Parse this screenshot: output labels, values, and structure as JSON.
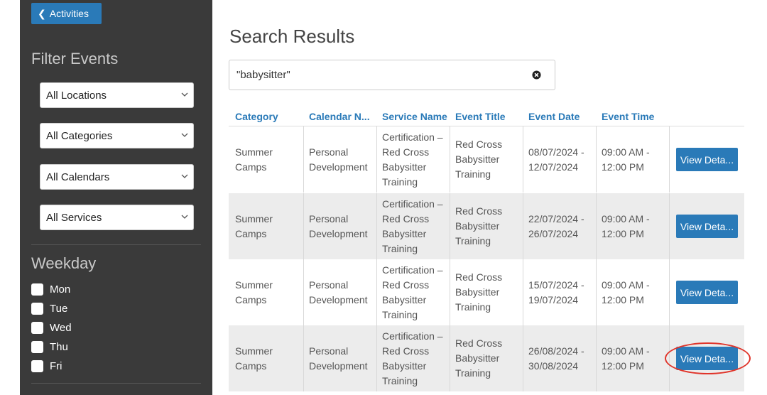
{
  "sidebar": {
    "back_label": "Activities",
    "filter_title": "Filter Events",
    "selects": [
      {
        "value": "All Locations"
      },
      {
        "value": "All Categories"
      },
      {
        "value": "All Calendars"
      },
      {
        "value": "All Services"
      }
    ],
    "weekday_title": "Weekday",
    "days": [
      "Mon",
      "Tue",
      "Wed",
      "Thu",
      "Fri"
    ]
  },
  "main": {
    "title": "Search Results",
    "search_value": "\"babysitter\"",
    "columns": [
      "Category",
      "Calendar N...",
      "Service Name",
      "Event Title",
      "Event Date",
      "Event Time"
    ],
    "rows": [
      {
        "category": [
          "Summer",
          "Camps"
        ],
        "calendar": [
          "Personal",
          "Development"
        ],
        "service": [
          "Certification –",
          "Red Cross",
          "Babysitter",
          "Training"
        ],
        "title": [
          "Red Cross",
          "Babysitter",
          "Training"
        ],
        "date": [
          "08/07/2024 -",
          "12/07/2024"
        ],
        "time": [
          "09:00 AM -",
          "12:00 PM"
        ],
        "button": "View Deta..."
      },
      {
        "category": [
          "Summer",
          "Camps"
        ],
        "calendar": [
          "Personal",
          "Development"
        ],
        "service": [
          "Certification –",
          "Red Cross",
          "Babysitter",
          "Training"
        ],
        "title": [
          "Red Cross",
          "Babysitter",
          "Training"
        ],
        "date": [
          "22/07/2024 -",
          "26/07/2024"
        ],
        "time": [
          "09:00 AM -",
          "12:00 PM"
        ],
        "button": "View Deta..."
      },
      {
        "category": [
          "Summer",
          "Camps"
        ],
        "calendar": [
          "Personal",
          "Development"
        ],
        "service": [
          "Certification –",
          "Red Cross",
          "Babysitter",
          "Training"
        ],
        "title": [
          "Red Cross",
          "Babysitter",
          "Training"
        ],
        "date": [
          "15/07/2024 -",
          "19/07/2024"
        ],
        "time": [
          "09:00 AM -",
          "12:00 PM"
        ],
        "button": "View Deta..."
      },
      {
        "category": [
          "Summer",
          "Camps"
        ],
        "calendar": [
          "Personal",
          "Development"
        ],
        "service": [
          "Certification –",
          "Red Cross",
          "Babysitter",
          "Training"
        ],
        "title": [
          "Red Cross",
          "Babysitter",
          "Training"
        ],
        "date": [
          "26/08/2024 -",
          "30/08/2024"
        ],
        "time": [
          "09:00 AM -",
          "12:00 PM"
        ],
        "button": "View Deta..."
      }
    ]
  },
  "colors": {
    "accent": "#2a7ab8",
    "sidebar_bg": "#3a3a3a",
    "highlight": "#e0352b"
  }
}
